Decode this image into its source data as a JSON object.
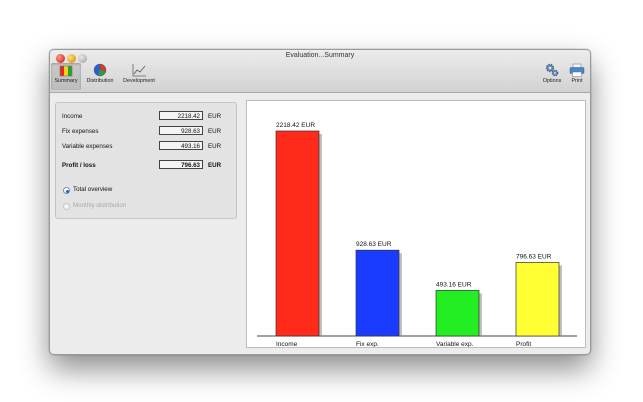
{
  "window": {
    "title": "Evaluation...Summary"
  },
  "toolbar": {
    "left": [
      {
        "label": "Summary",
        "icon": "summary-flag-icon",
        "selected": true
      },
      {
        "label": "Distribution",
        "icon": "pie-chart-icon",
        "selected": false
      },
      {
        "label": "Development",
        "icon": "line-chart-icon",
        "selected": false
      }
    ],
    "right": [
      {
        "label": "Options",
        "icon": "gears-icon"
      },
      {
        "label": "Print",
        "icon": "printer-icon"
      }
    ]
  },
  "summary": {
    "rows": [
      {
        "label": "Income",
        "value": "2218.42",
        "unit": "EUR"
      },
      {
        "label": "Fix expenses",
        "value": "928.63",
        "unit": "EUR"
      },
      {
        "label": "Variable expenses",
        "value": "493.16",
        "unit": "EUR"
      },
      {
        "label": "Profit / loss",
        "value": "796.63",
        "unit": "EUR"
      }
    ],
    "options": [
      {
        "label": "Total overview",
        "selected": true
      },
      {
        "label": "Monthly distribution",
        "selected": false
      }
    ]
  },
  "chart_data": {
    "type": "bar",
    "categories": [
      "Income",
      "Fix exp.",
      "Variable exp.",
      "Profit"
    ],
    "values": [
      2218.42,
      928.63,
      493.16,
      796.63
    ],
    "data_labels": [
      "2218.42 EUR",
      "928.63 EUR",
      "493.16 EUR",
      "796.63 EUR"
    ],
    "colors": [
      "#ff2a1a",
      "#1a3cff",
      "#22ee22",
      "#ffff33"
    ],
    "title": "",
    "xlabel": "",
    "ylabel": "",
    "ylim": [
      0,
      2218.42
    ],
    "grid": false
  }
}
